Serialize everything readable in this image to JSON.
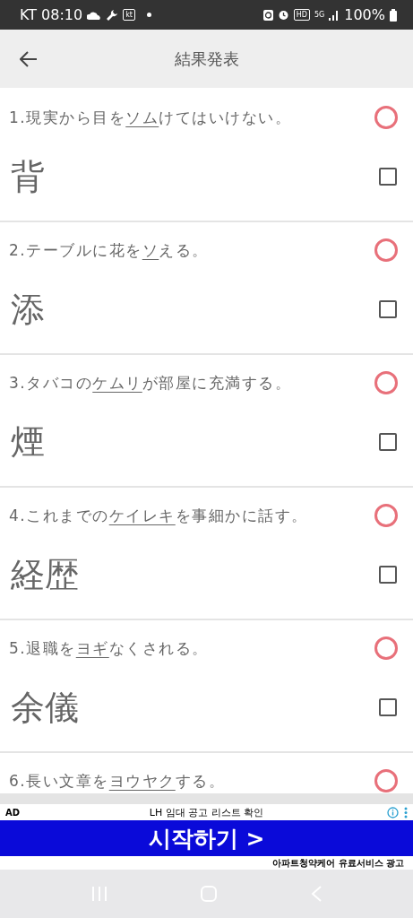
{
  "status_bar": {
    "carrier_time": "KT 08:10",
    "carrier_badge": "kt",
    "hd_badge": "HD",
    "network": "5G",
    "battery": "100%"
  },
  "app_bar": {
    "title": "結果発表"
  },
  "questions": [
    {
      "prefix": "1.現実から目を",
      "underlined": "ソム",
      "suffix": "けてはいけない。",
      "correct": true,
      "answer": "背",
      "checked": false
    },
    {
      "prefix": "2.テーブルに花を",
      "underlined": "ソ",
      "suffix": "える。",
      "correct": true,
      "answer": "添",
      "checked": false
    },
    {
      "prefix": "3.タバコの",
      "underlined": "ケムリ",
      "suffix": "が部屋に充満する。",
      "correct": true,
      "answer": "煙",
      "checked": false
    },
    {
      "prefix": "4.これまでの",
      "underlined": "ケイレキ",
      "suffix": "を事細かに話す。",
      "correct": true,
      "answer": "経歴",
      "checked": false
    },
    {
      "prefix": "5.退職を",
      "underlined": "ヨギ",
      "suffix": "なくされる。",
      "correct": true,
      "answer": "余儀",
      "checked": false
    },
    {
      "prefix": "6.長い文章を",
      "underlined": "ヨウヤク",
      "suffix": "する。",
      "correct": true
    }
  ],
  "ad": {
    "label": "AD",
    "headline": "LH 임대 공고 리스트 확인",
    "button": "시작하기 >",
    "footer": "아파트청약케어 유료서비스 광고"
  }
}
